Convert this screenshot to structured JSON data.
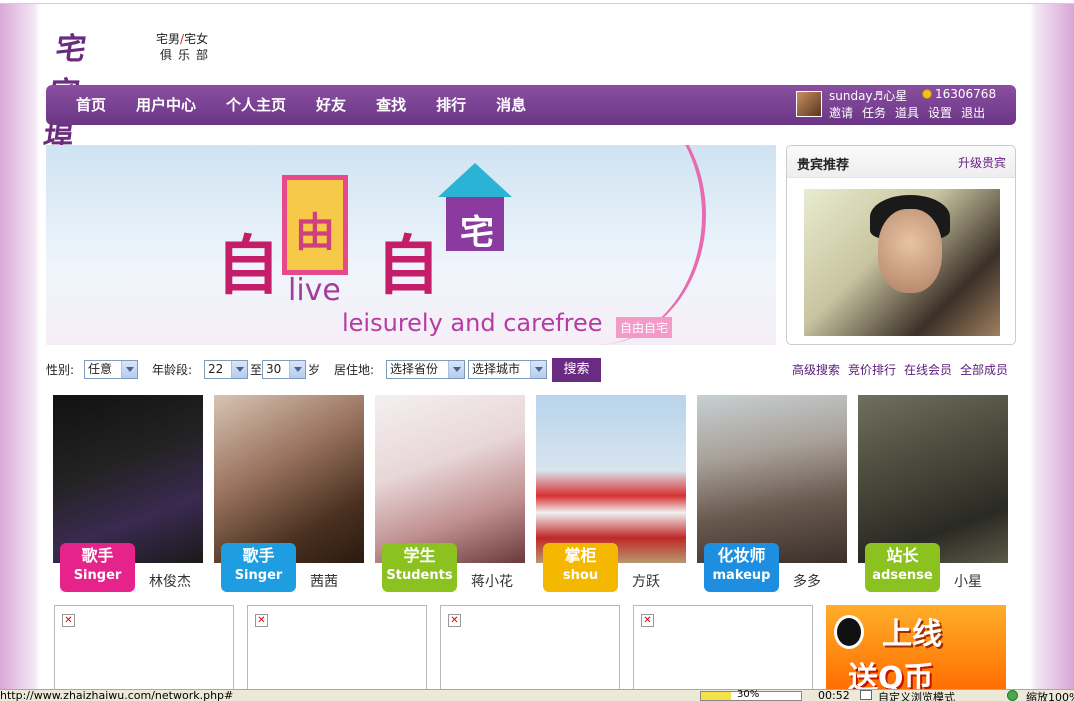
{
  "logo": {
    "mark": "宅宅埠",
    "sub_male": "宅男",
    "slash": "/",
    "sub_female": "宅女",
    "club": "俱乐部"
  },
  "nav": {
    "items": [
      "首页",
      "用户中心",
      "个人主页",
      "好友",
      "查找",
      "排行",
      "消息"
    ]
  },
  "user": {
    "name": "sunday♬心星",
    "coins": "16306768",
    "links": [
      "邀请",
      "任务",
      "道具",
      "设置",
      "退出"
    ]
  },
  "banner": {
    "ch1": "自",
    "ch2": "由",
    "ch3": "自",
    "ch4": "宅",
    "live": "live",
    "tagline": "leisurely and carefree",
    "tagbox": "自由自宅"
  },
  "vip": {
    "title": "贵宾推荐",
    "upgrade": "升级贵宾"
  },
  "search": {
    "gender_label": "性别:",
    "gender_value": "任意",
    "age_label": "年龄段:",
    "age_from": "22",
    "age_to_label": "至",
    "age_to": "30",
    "age_unit": "岁",
    "location_label": "居住地:",
    "province": "选择省份",
    "city": "选择城市",
    "button": "搜索",
    "links": [
      "高级搜索",
      "竞价排行",
      "在线会员",
      "全部成员"
    ]
  },
  "members": [
    {
      "badge_cn": "歌手",
      "badge_en": "Singer",
      "name": "林俊杰",
      "badge_color": "#e5238a"
    },
    {
      "badge_cn": "歌手",
      "badge_en": "Singer",
      "name": "茜茜",
      "badge_color": "#1e9ee0"
    },
    {
      "badge_cn": "学生",
      "badge_en": "Students",
      "name": "蒋小花",
      "badge_color": "#8cc21f"
    },
    {
      "badge_cn": "掌柜",
      "badge_en": "shou",
      "name": "方跃",
      "badge_color": "#f5b800"
    },
    {
      "badge_cn": "化妆师",
      "badge_en": "makeup",
      "name": "多多",
      "badge_color": "#1e8fe0"
    },
    {
      "badge_cn": "站长",
      "badge_en": "adsense",
      "name": "小星",
      "badge_color": "#8cc21f"
    }
  ],
  "ads": {
    "qq_line1": "上线",
    "qq_line2": "送Q币"
  },
  "statusbar": {
    "url": "http://www.zhaizhaiwu.com/network.php#",
    "progress_label": "30%",
    "progress_fraction": 0.3,
    "time": "00:52",
    "mode": "自定义浏览模式",
    "zoom": "缩放100%"
  }
}
